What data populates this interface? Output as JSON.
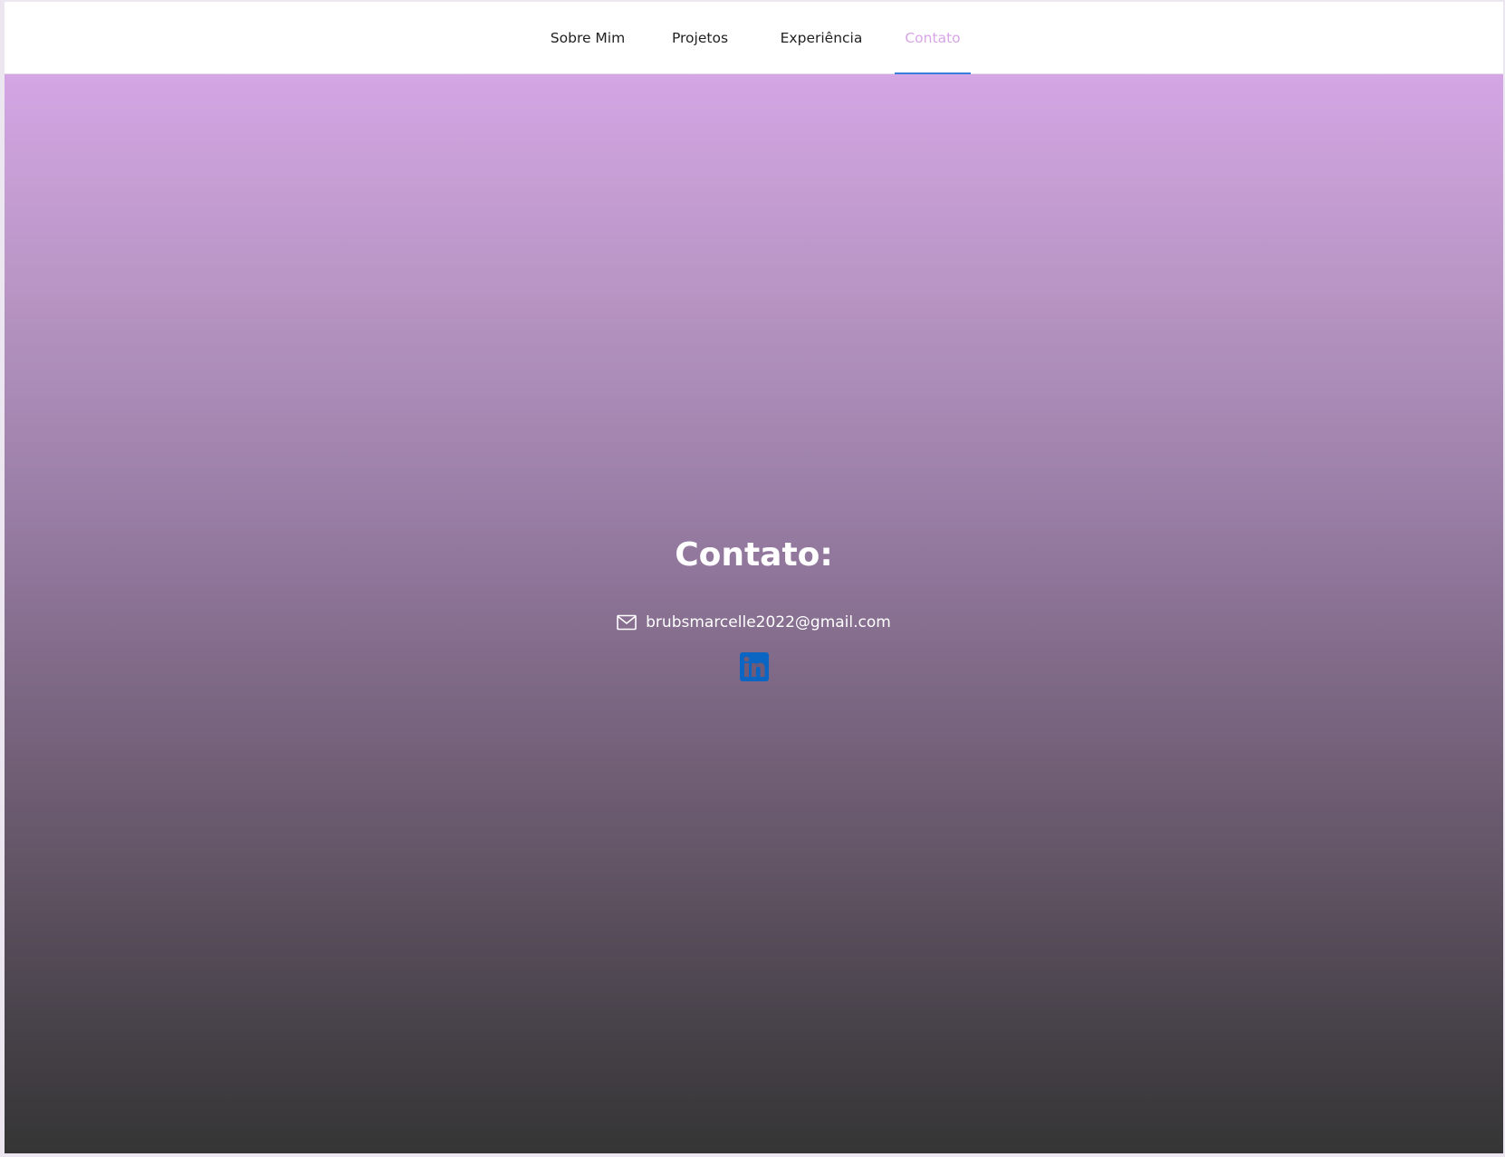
{
  "nav": {
    "items": [
      {
        "label": "Sobre Mim",
        "active": false
      },
      {
        "label": "Projetos",
        "active": false
      },
      {
        "label": "Experiência",
        "active": false
      },
      {
        "label": "Contato",
        "active": true
      }
    ]
  },
  "contact": {
    "title": "Contato:",
    "email": "brubsmarcelle2022@gmail.com",
    "icons": {
      "email": "mail-icon",
      "linkedin": "linkedin-icon"
    }
  },
  "colors": {
    "active_nav": "#d8a5e6",
    "active_underline": "#3b7ddd",
    "gradient_top": "#d4a6e4",
    "gradient_bottom": "#353535",
    "linkedin": "#0a66c2"
  }
}
